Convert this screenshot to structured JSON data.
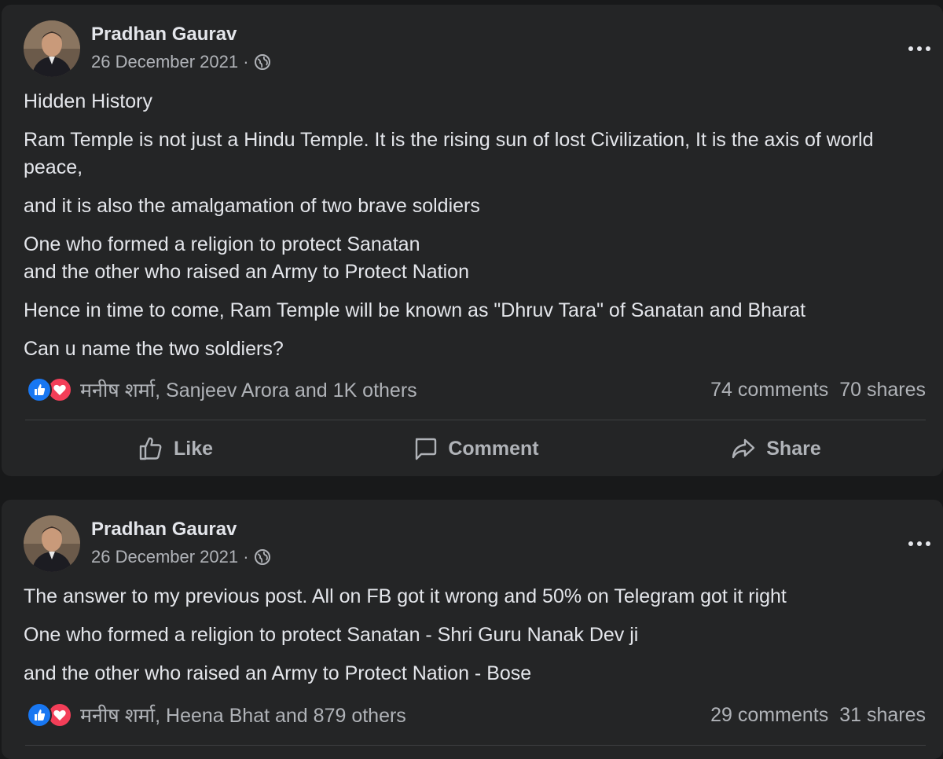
{
  "posts": [
    {
      "author": "Pradhan Gaurav",
      "date": "26 December 2021 ·",
      "paragraphs": [
        "Hidden History",
        "Ram Temple is not just a Hindu Temple. It is the rising sun of lost Civilization, It is the axis of world peace,",
        "and it is also the amalgamation of two brave soldiers",
        "One who formed a religion to protect Sanatan",
        "and the other who raised an Army to Protect Nation",
        "Hence in time to come, Ram Temple will be known as \"Dhruv Tara\" of Sanatan and Bharat",
        "Can u name the two soldiers?"
      ],
      "reactions_text": "मनीष शर्मा, Sanjeev Arora and 1K others",
      "comments": "74 comments",
      "shares": "70 shares",
      "actions": {
        "like": "Like",
        "comment": "Comment",
        "share": "Share"
      }
    },
    {
      "author": "Pradhan Gaurav",
      "date": "26 December 2021 ·",
      "paragraphs": [
        "The answer to my previous post. All on FB got it wrong and 50% on Telegram got it right",
        "One who formed a religion to protect Sanatan - Shri Guru Nanak Dev ji",
        "and the other who raised an Army to Protect Nation - Bose"
      ],
      "reactions_text": "मनीष शर्मा, Heena Bhat and 879 others",
      "comments": "29 comments",
      "shares": "31 shares"
    }
  ],
  "icons": {
    "privacy": "globe-icon",
    "menu": "more-options-icon",
    "reaction_like": "like-reaction-icon",
    "reaction_love": "love-reaction-icon"
  },
  "colors": {
    "background": "#18191a",
    "card": "#242526",
    "text_primary": "#e4e6eb",
    "text_secondary": "#b0b3b8",
    "like_blue": "#1877f2",
    "love_red": "#f33e58"
  }
}
